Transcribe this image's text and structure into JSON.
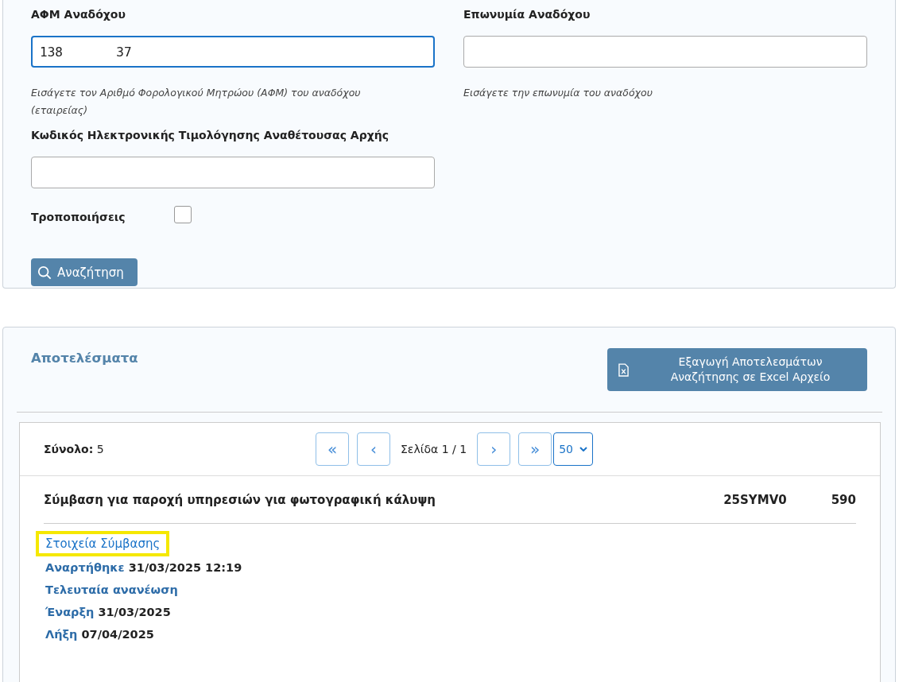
{
  "search_form": {
    "fields": [
      {
        "kind": "text",
        "label": "ΑΦΜ Αναδόχου",
        "value": "138       37",
        "focused": true,
        "hint": "Εισάγετε τον Αριθμό Φορολογικού Μητρώου (ΑΦΜ) του αναδόχου (εταιρείας)"
      },
      {
        "kind": "text",
        "label": "Επωνυμία Αναδόχου",
        "focused": false,
        "hint": "Εισάγετε την επωνυμία του αναδόχου"
      },
      {
        "kind": "text",
        "label": "Κωδικός Ηλεκτρονικής Τιμολόγησης Αναθέτουσας Αρχής",
        "focused": false
      },
      {
        "kind": "checkbox",
        "label": "Τροποποιήσεις",
        "checked": false
      }
    ],
    "search_button": "Αναζήτηση"
  },
  "results": {
    "title": "Αποτελέσματα",
    "export_button": "Εξαγωγή Αποτελεσμάτων Αναζήτησης σε Excel Αρχείο",
    "total_label": "Σύνολο:",
    "total": "5",
    "first_page": "«",
    "prev_page": "‹",
    "page_info": "Σελίδα 1 / 1",
    "next_page": "›",
    "last_page": "»",
    "page_size": "50",
    "items": [
      {
        "title": "Σύμβαση για παροχή υπηρεσιών για φωτογραφική κάλυψη",
        "code": "25SYMV0",
        "number": "590",
        "link": "Στοιχεία Σύμβασης",
        "link_highlighted": true,
        "details": [
          {
            "label": "Αναρτήθηκε",
            "value": "31/03/2025 12:19"
          },
          {
            "label": "Τελευταία ανανέωση"
          },
          {
            "label": "Έναρξη",
            "value": "31/03/2025"
          },
          {
            "label": "Λήξη",
            "value": "07/04/2025"
          }
        ]
      }
    ]
  }
}
